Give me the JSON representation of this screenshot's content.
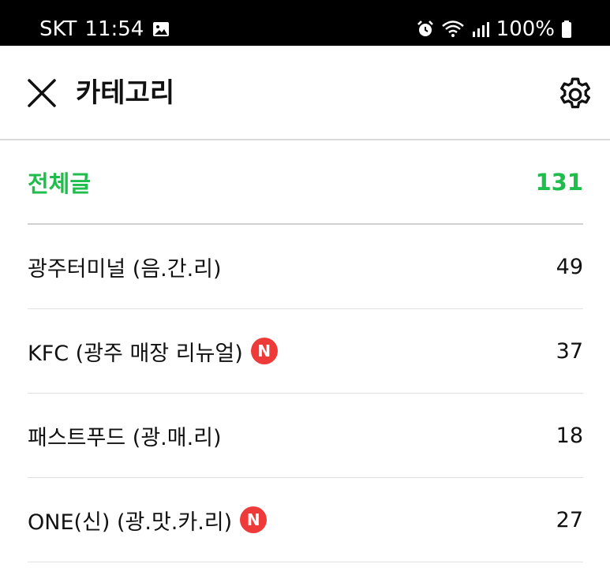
{
  "status_bar": {
    "carrier": "SKT",
    "time": "11:54",
    "battery": "100%",
    "icons": [
      "image-icon",
      "alarm-icon",
      "wifi-icon",
      "signal-icon",
      "battery-icon"
    ]
  },
  "header": {
    "title": "카테고리",
    "close_icon": "close-icon",
    "settings_icon": "gear-icon"
  },
  "total": {
    "label": "전체글",
    "count": "131",
    "color": "#1fbd4b"
  },
  "categories": [
    {
      "label": "광주터미널 (음.간.리)",
      "count": "49",
      "is_new": false
    },
    {
      "label": "KFC (광주 매장 리뉴얼)",
      "count": "37",
      "is_new": true,
      "badge": "N"
    },
    {
      "label": "패스트푸드 (광.매.리)",
      "count": "18",
      "is_new": false
    },
    {
      "label": "ONE(신) (광.맛.카.리)",
      "count": "27",
      "is_new": true,
      "badge": "N"
    }
  ],
  "badge_color": "#ef3a3a"
}
